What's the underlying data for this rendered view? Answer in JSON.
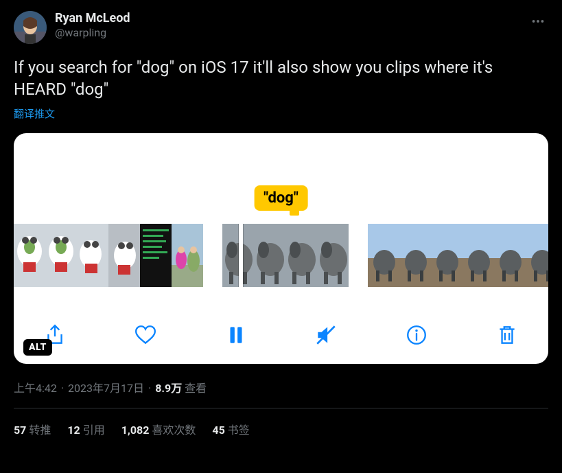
{
  "author": {
    "display_name": "Ryan McLeod",
    "handle": "@warpling"
  },
  "tweet_text": "If you search for \"dog\" on iOS 17 it'll also show you clips where it's HEARD \"dog\"",
  "translate_label": "翻译推文",
  "media": {
    "tooltip_text": "\"dog\"",
    "alt_badge": "ALT",
    "toolbar": {
      "share": "share",
      "like": "like",
      "pause": "pause",
      "mute": "mute",
      "info": "info",
      "delete": "delete"
    }
  },
  "meta": {
    "time": "上午4:42",
    "date": "2023年7月17日",
    "views_count": "8.9万",
    "views_label": "查看"
  },
  "stats": {
    "retweets_count": "57",
    "retweets_label": "转推",
    "quotes_count": "12",
    "quotes_label": "引用",
    "likes_count": "1,082",
    "likes_label": "喜欢次数",
    "bookmarks_count": "45",
    "bookmarks_label": "书签"
  }
}
